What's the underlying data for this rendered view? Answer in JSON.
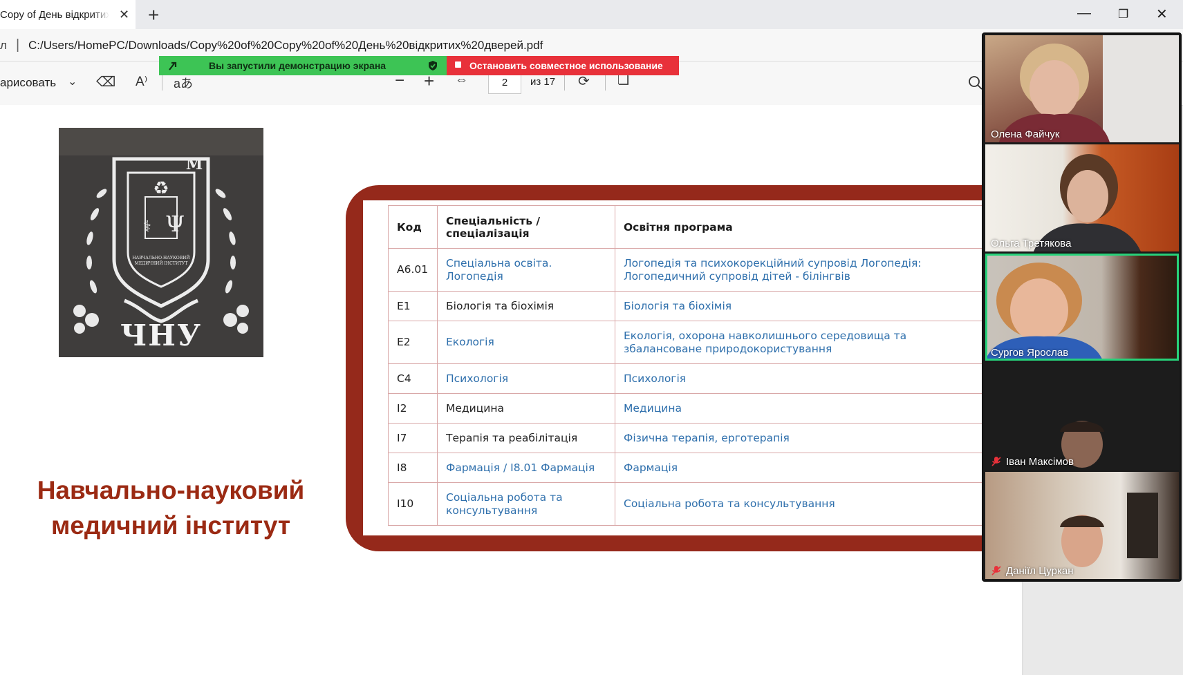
{
  "browser": {
    "tab_title": "Copy of День відкритих дверей",
    "address_prefix": "л",
    "url": "C:/Users/HomePC/Downloads/Copy%20of%20Copy%20of%20День%20відкритих%20дверей.pdf"
  },
  "pdf_toolbar": {
    "draw_label": "арисовать",
    "current_page": "2",
    "page_total": "из 17",
    "translate_glyph": "aあ",
    "read_aloud_glyph": "A⁾"
  },
  "screen_share": {
    "status_label": "Вы запустили демонстрацию экрана",
    "stop_label": "Остановить совместное использование",
    "status_color": "#3dc455",
    "stop_color": "#e8313a"
  },
  "slide": {
    "logo_text": "ЧНУ",
    "logo_caption": "НАВЧАЛЬНО-НАУКОВИЙ МЕДИЧНИЙ ІНСТИТУТ",
    "institute_title_line1": "Навчально-науковий",
    "institute_title_line2": "медичний інститут",
    "accent_color": "#95291b",
    "table_headers": {
      "code": "Код",
      "specialty": "Спеціальність / спеціалізація",
      "program": "Освітня програма"
    },
    "table_rows": [
      {
        "code": "А6.01",
        "specialty": "Спеціальна освіта. Логопедія",
        "program": "Логопедія та психокорекційний супровід Логопедія: Логопедичний супровід дітей - білінгвів"
      },
      {
        "code": "E1",
        "specialty": "Біологія та біохімія",
        "program": "Біологія та біохімія"
      },
      {
        "code": "E2",
        "specialty": "Екологія",
        "program": "Екологія, охорона навколишнього середовища та збалансоване природокористування"
      },
      {
        "code": "C4",
        "specialty": "Психологія",
        "program": "Психологія"
      },
      {
        "code": "I2",
        "specialty": "Медицина",
        "program": "Медицина"
      },
      {
        "code": "I7",
        "specialty": "Терапія та реабілітація",
        "program": "Фізична терапія, ерготерапія"
      },
      {
        "code": "I8",
        "specialty": "Фармація / I8.01 Фармація",
        "program": "Фармація"
      },
      {
        "code": "I10",
        "specialty": "Соціальна робота та консультування",
        "program": "Соціальна робота та консультування"
      }
    ]
  },
  "participants": [
    {
      "name": "Олена Файчук",
      "muted": false,
      "active": false
    },
    {
      "name": "Ольга Третякова",
      "muted": false,
      "active": false
    },
    {
      "name": "Сургов Ярослав",
      "muted": false,
      "active": true
    },
    {
      "name": "Іван Максімов",
      "muted": true,
      "active": false
    },
    {
      "name": "Даніїл Цуркан",
      "muted": true,
      "active": false
    }
  ]
}
